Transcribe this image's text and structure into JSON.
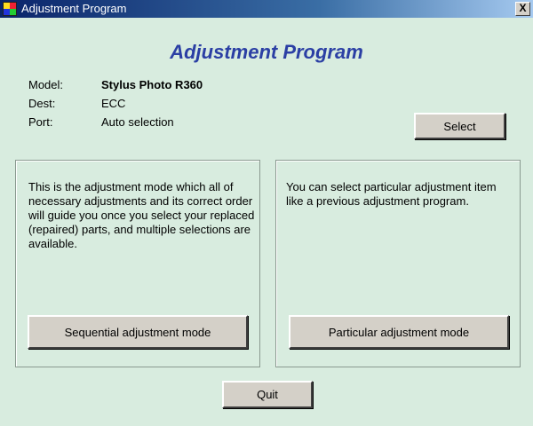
{
  "window": {
    "title": "Adjustment Program",
    "close_label": "X"
  },
  "heading": "Adjustment Program",
  "info": {
    "model_label": "Model:",
    "model_value": "Stylus Photo R360",
    "dest_label": "Dest:",
    "dest_value": "ECC",
    "port_label": "Port:",
    "port_value": "Auto selection"
  },
  "buttons": {
    "select": "Select",
    "sequential": "Sequential adjustment mode",
    "particular": "Particular adjustment mode",
    "quit": "Quit"
  },
  "panels": {
    "sequential_description": "This is the adjustment mode which all of necessary adjustments and its correct order will guide you once you select your replaced (repaired) parts, and multiple selections are available.",
    "particular_description": "You can select particular adjustment item like a previous adjustment program."
  },
  "colors": {
    "background": "#d8ecdf",
    "heading": "#2b3fa4",
    "titlebar_start": "#0a246a",
    "titlebar_end": "#a6caf0",
    "button_face": "#d4d0c8"
  },
  "icons": {
    "app": "app-icon",
    "close": "close-icon"
  }
}
